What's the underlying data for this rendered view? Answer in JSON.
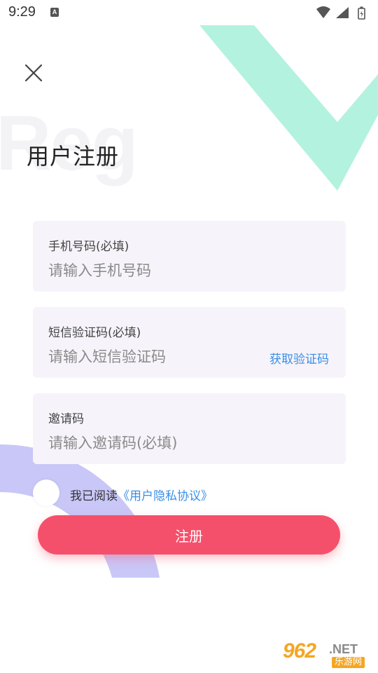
{
  "status_bar": {
    "time": "9:29",
    "notification_letter": "A"
  },
  "page": {
    "watermark": "Reg",
    "title": "用户注册"
  },
  "form": {
    "phone": {
      "label": "手机号码(必填)",
      "placeholder": "请输入手机号码"
    },
    "sms_code": {
      "label": "短信验证码(必填)",
      "placeholder": "请输入短信验证码",
      "get_code_label": "获取验证码"
    },
    "invite_code": {
      "label": "邀请码",
      "placeholder": "请输入邀请码(必填)"
    }
  },
  "agreement": {
    "prefix": "我已阅读",
    "link": "《用户隐私协议》",
    "checked": false
  },
  "register_button": {
    "label": "注册"
  },
  "watermark_logo": {
    "number": "962",
    "suffix": ".NET",
    "cn": "乐游网"
  },
  "colors": {
    "accent": "#f5506b",
    "link": "#3a8ee6",
    "deco_green": "#b3f2de",
    "deco_purple": "#c9c7f7",
    "field_bg": "#f6f4fa"
  },
  "icons": {
    "close": "close-icon",
    "wifi": "wifi-icon",
    "signal": "signal-icon",
    "battery": "battery-icon"
  }
}
